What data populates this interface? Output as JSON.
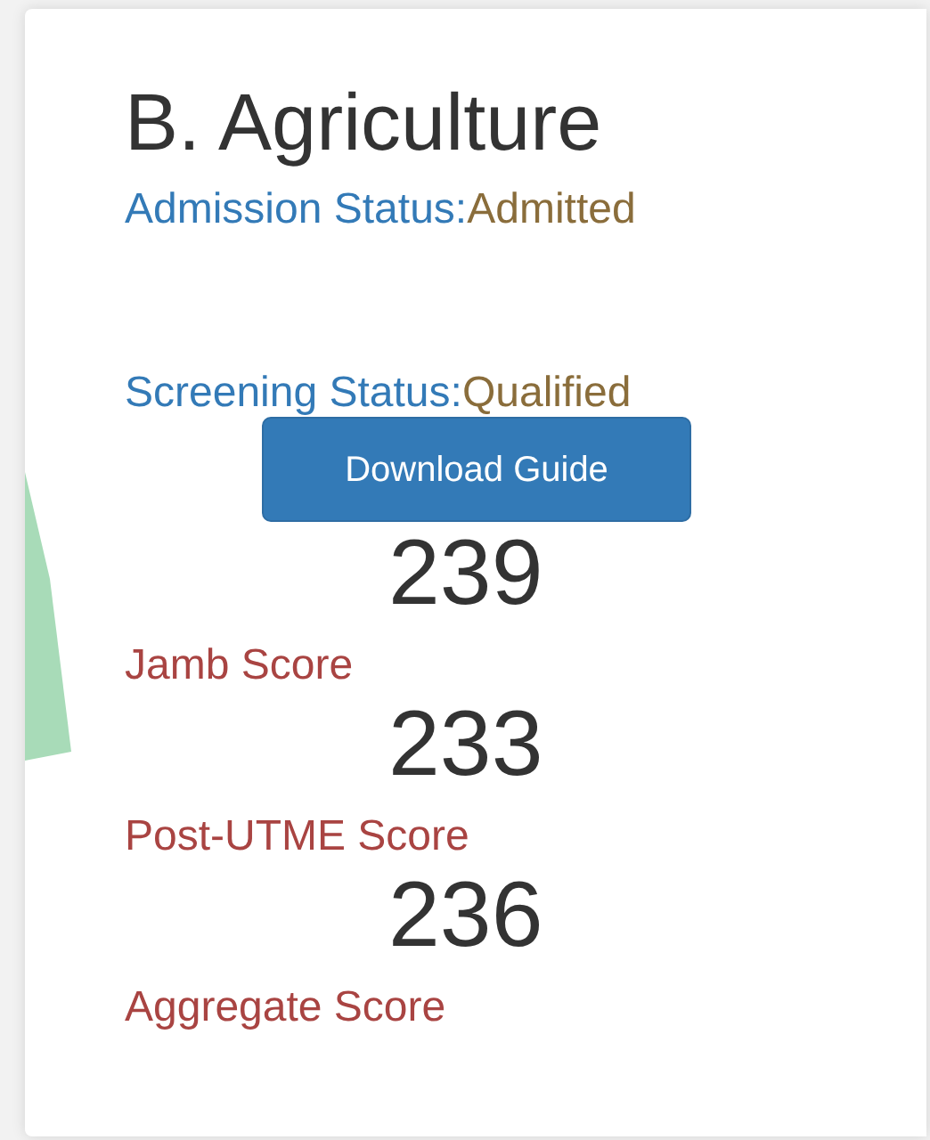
{
  "title": "B. Agriculture",
  "statuses": [
    {
      "label": "Admission Status:",
      "value": "Admitted"
    },
    {
      "label": "Screening Status:",
      "value": "Qualified"
    }
  ],
  "button": "Download Guide",
  "score_lines": [
    {
      "kind": "number",
      "text": "239"
    },
    {
      "kind": "label",
      "text": "Jamb Score"
    },
    {
      "kind": "number",
      "text": "233"
    },
    {
      "kind": "label",
      "text": "Post-UTME Score"
    },
    {
      "kind": "number",
      "text": "236"
    },
    {
      "kind": "label",
      "text": "Aggregate Score"
    }
  ]
}
